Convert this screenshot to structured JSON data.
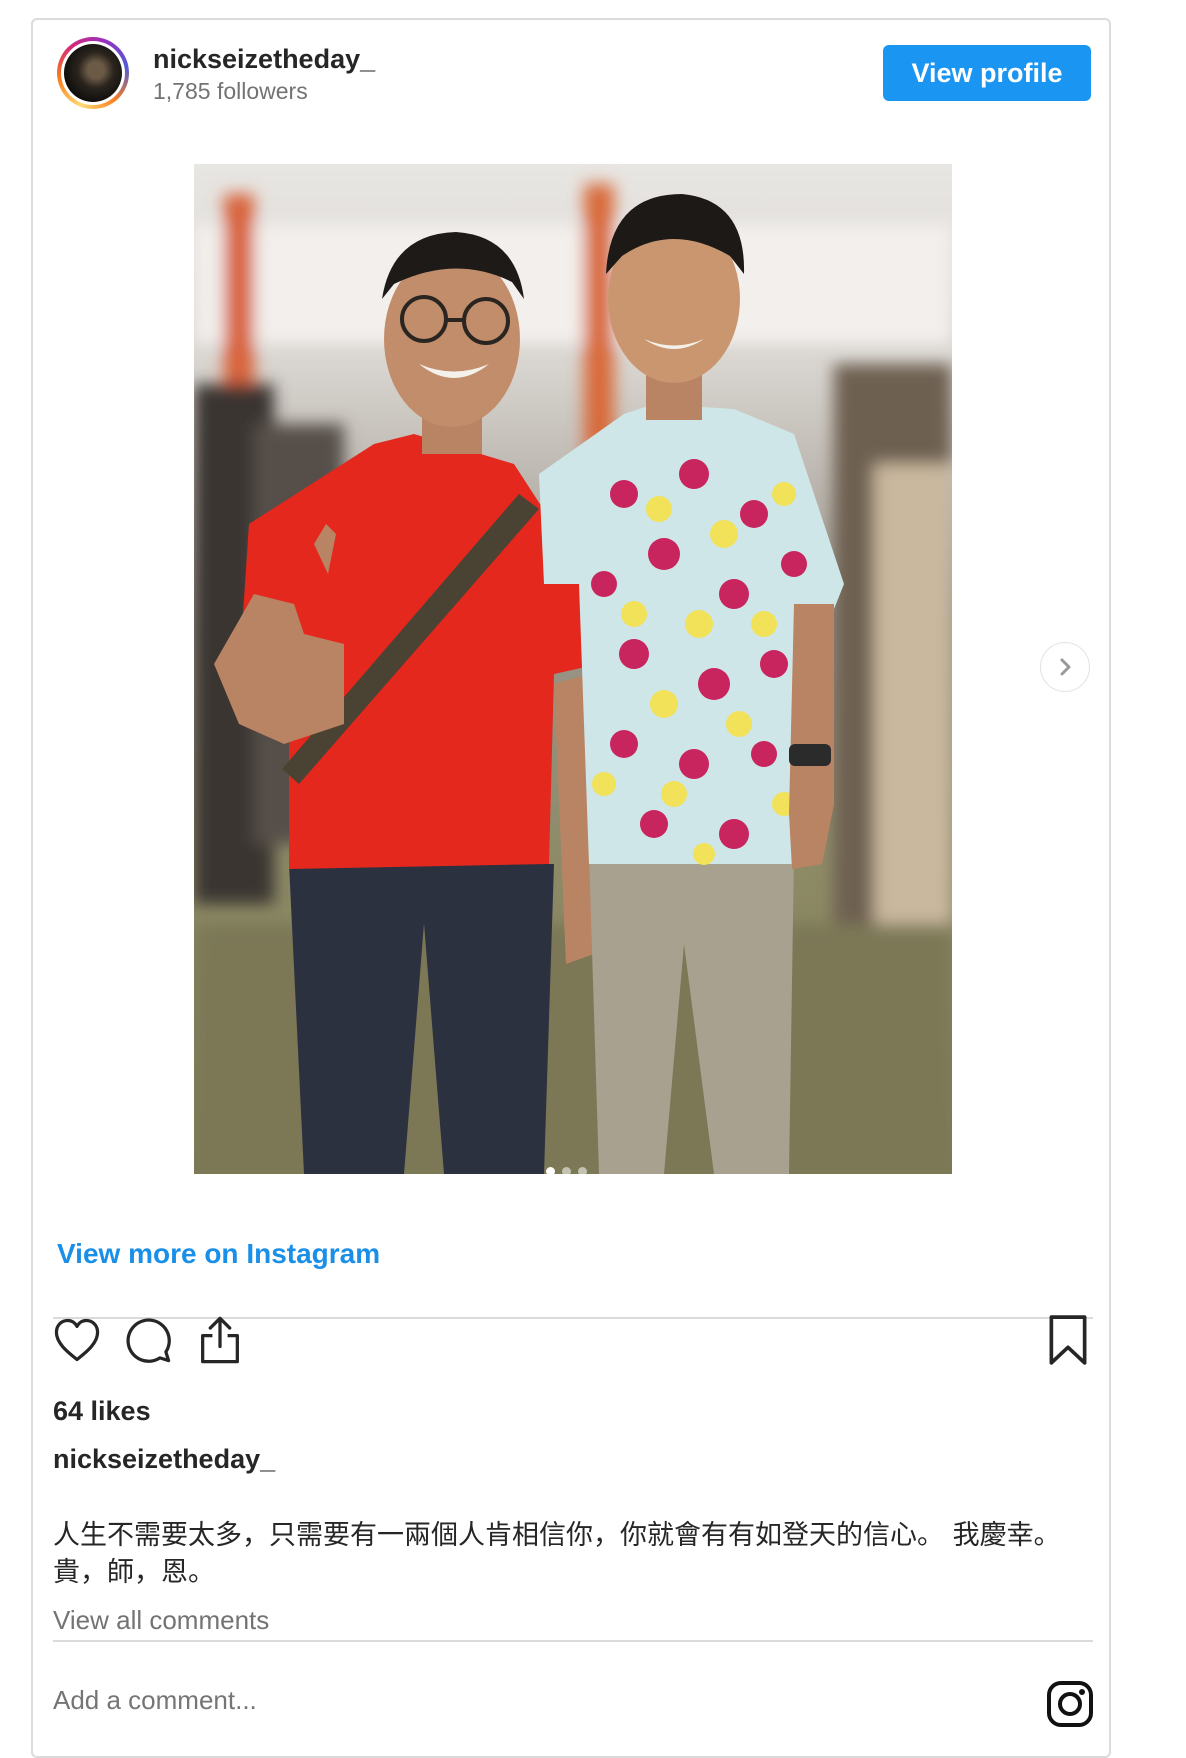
{
  "header": {
    "username": "nickseizetheday_",
    "followers": "1,785 followers",
    "view_profile_label": "View profile"
  },
  "carousel": {
    "slide_count": 3,
    "active_slide": 1
  },
  "view_more_label": "View more on Instagram",
  "actions": {
    "like_icon": "heart-icon",
    "comment_icon": "comment-icon",
    "share_icon": "share-icon",
    "save_icon": "bookmark-icon"
  },
  "likes": "64 likes",
  "caption": {
    "username": "nickseizetheday_",
    "text": "人生不需要太多，只需要有一兩個人肯相信你，你就會有有如登天的信心。 我慶幸。 貴，師，恩。"
  },
  "view_all_comments_label": "View all comments",
  "comment_box": {
    "placeholder": "Add a comment..."
  },
  "colors": {
    "accent_blue": "#1a95f1",
    "link_blue": "#1a8fe8",
    "text": "#262626",
    "muted": "#737373",
    "border": "#dbdbdb"
  }
}
